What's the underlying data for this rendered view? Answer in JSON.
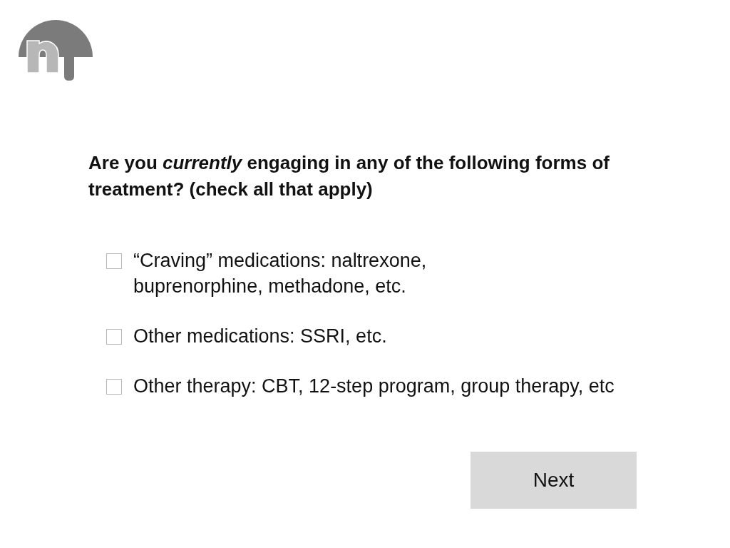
{
  "question": "Are you *currently* engaging in any of the following forms of treatment? (check all that apply)",
  "options": [
    {
      "lines": [
        "“Craving” medications: naltrexone,",
        "buprenorphine, methadone, etc."
      ],
      "checked": false
    },
    {
      "lines": [
        "Other medications: SSRI, etc."
      ],
      "checked": false
    },
    {
      "lines": [
        "Other therapy: CBT, 12-step program, group therapy, etc"
      ],
      "checked": false
    }
  ],
  "next_button": {
    "label": "Next"
  }
}
